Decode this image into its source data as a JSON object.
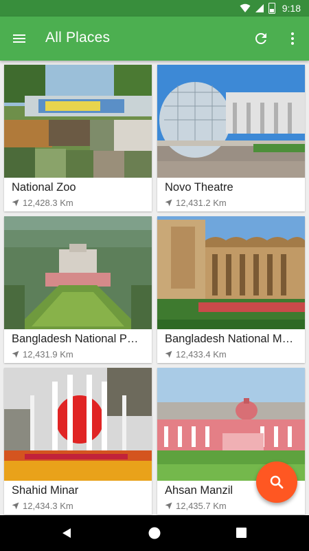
{
  "status_bar": {
    "time": "9:18",
    "battery_level": "9"
  },
  "app_bar": {
    "title": "All Places"
  },
  "places": [
    {
      "name": "National Zoo",
      "distance": "12,428.3 Km"
    },
    {
      "name": "Novo Theatre",
      "distance": "12,431.2 Km"
    },
    {
      "name": "Bangladesh National P…",
      "distance": "12,431.9 Km"
    },
    {
      "name": "Bangladesh National M…",
      "distance": "12,433.4 Km"
    },
    {
      "name": "Shahid Minar",
      "distance": "12,434.3 Km"
    },
    {
      "name": "Ahsan Manzil",
      "distance": "12,435.7 Km"
    }
  ],
  "colors": {
    "primary": "#4CAF50",
    "primary_dark": "#388E3C",
    "accent": "#FF5722"
  },
  "icons": {
    "menu": "menu-icon",
    "refresh": "refresh-icon",
    "more": "more-vert-icon",
    "location": "navigation-arrow-icon",
    "fab": "search-icon"
  }
}
